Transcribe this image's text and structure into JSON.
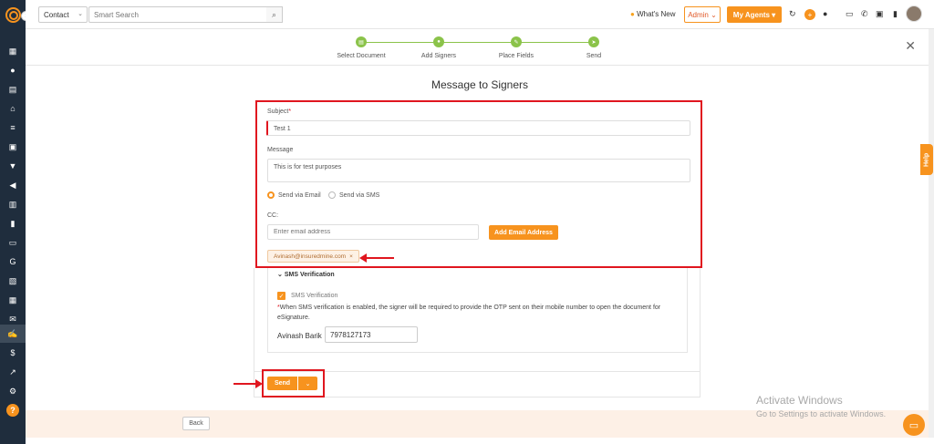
{
  "header": {
    "contact_select": "Contact",
    "search_placeholder": "Smart Search",
    "whats_new": "What's New",
    "admin": "Admin",
    "my_agents": "My Agents"
  },
  "steps": [
    {
      "label": "Select Document"
    },
    {
      "label": "Add Signers"
    },
    {
      "label": "Place Fields"
    },
    {
      "label": "Send"
    }
  ],
  "page_title": "Message to Signers",
  "form": {
    "subject_label": "Subject",
    "subject_required": "*",
    "subject_value": "Test 1",
    "message_label": "Message",
    "message_value": "This is for test purposes",
    "send_via_email": "Send via Email",
    "send_via_sms": "Send via SMS",
    "cc_label": "CC:",
    "email_placeholder": "Enter email address",
    "add_email_button": "Add Email Address",
    "cc_chip": "Avinash@insuredmine.com",
    "cc_chip_remove": "×"
  },
  "sms": {
    "heading": "SMS Verification",
    "checkbox_label": "SMS Verification",
    "note_star": "*",
    "note": "When SMS verification is enabled, the signer will be required to provide the OTP sent on their mobile number to open the document for eSignature.",
    "signer_name": "Avinash Barik",
    "signer_phone": "7978127173"
  },
  "actions": {
    "send": "Send",
    "back": "Back"
  },
  "overlay": {
    "activate_title": "Activate Windows",
    "activate_sub": "Go to Settings to activate Windows.",
    "help_tab": "Help"
  },
  "colors": {
    "accent": "#f7931e",
    "step_green": "#8bc34a",
    "highlight_red": "#e0161f",
    "sidebar": "#1f2d3d"
  }
}
